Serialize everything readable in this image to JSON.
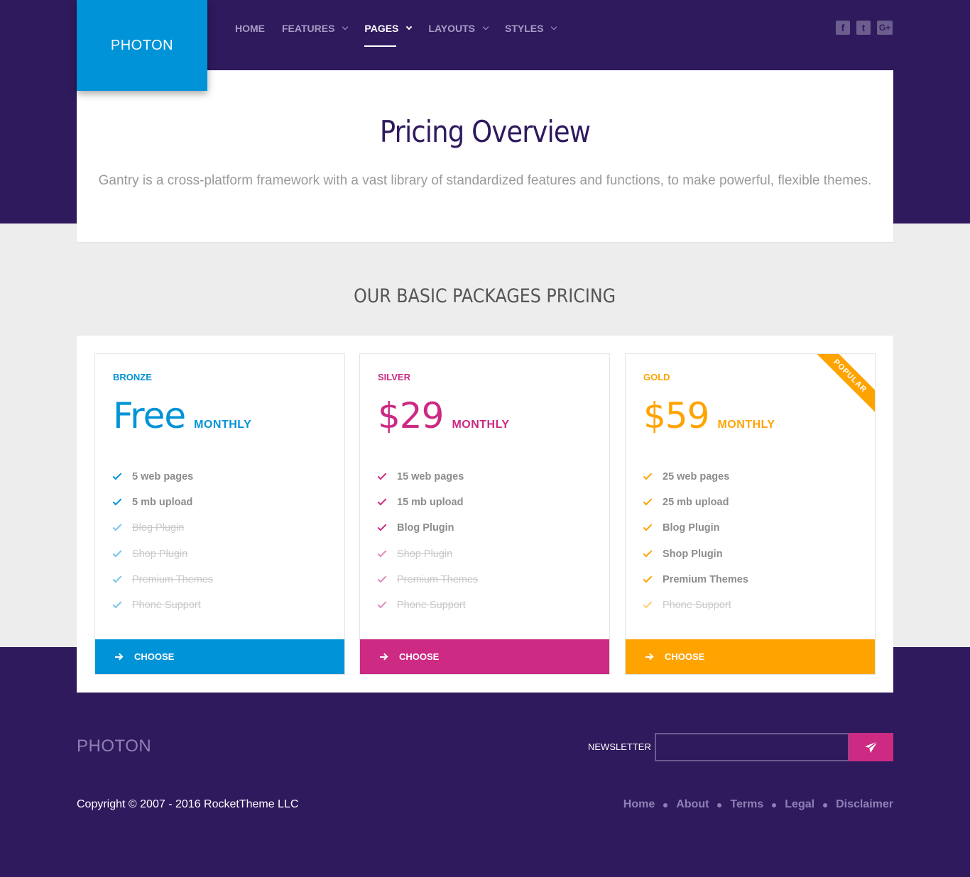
{
  "colors": {
    "brand_dark": "#2f1a5e",
    "bronze": "#0193d7",
    "silver": "#cc2a83",
    "gold": "#ffa300"
  },
  "header": {
    "logo": "PHOTON",
    "nav": [
      {
        "label": "HOME",
        "dropdown": false,
        "active": false
      },
      {
        "label": "FEATURES",
        "dropdown": true,
        "active": false
      },
      {
        "label": "PAGES",
        "dropdown": true,
        "active": true
      },
      {
        "label": "LAYOUTS",
        "dropdown": true,
        "active": false
      },
      {
        "label": "STYLES",
        "dropdown": true,
        "active": false
      }
    ],
    "social": [
      {
        "icon": "facebook-icon",
        "glyph": "f"
      },
      {
        "icon": "twitter-icon",
        "glyph": "t"
      },
      {
        "icon": "google-plus-icon",
        "glyph": "G+"
      }
    ]
  },
  "hero": {
    "title": "Pricing Overview",
    "subtitle": "Gantry is a cross-platform framework with a vast library of standardized features and functions, to make powerful, flexible themes."
  },
  "pricing": {
    "heading": "OUR BASIC PACKAGES PRICING",
    "plans": [
      {
        "tier": "BRONZE",
        "price": "Free",
        "period": "MONTHLY",
        "color": "#0193d7",
        "ribbon": "",
        "features": [
          {
            "label": "5 web pages",
            "included": true
          },
          {
            "label": "5 mb upload",
            "included": true
          },
          {
            "label": "Blog Plugin",
            "included": false
          },
          {
            "label": "Shop Plugin",
            "included": false
          },
          {
            "label": "Premium Themes",
            "included": false
          },
          {
            "label": "Phone Support",
            "included": false
          }
        ],
        "cta": "CHOOSE"
      },
      {
        "tier": "SILVER",
        "price": "$29",
        "period": "MONTHLY",
        "color": "#cc2a83",
        "ribbon": "",
        "features": [
          {
            "label": "15 web pages",
            "included": true
          },
          {
            "label": "15 mb upload",
            "included": true
          },
          {
            "label": "Blog Plugin",
            "included": true
          },
          {
            "label": "Shop Plugin",
            "included": false
          },
          {
            "label": "Premium Themes",
            "included": false
          },
          {
            "label": "Phone Support",
            "included": false
          }
        ],
        "cta": "CHOOSE"
      },
      {
        "tier": "GOLD",
        "price": "$59",
        "period": "MONTHLY",
        "color": "#ffa300",
        "ribbon": "POPULAR",
        "features": [
          {
            "label": "25 web pages",
            "included": true
          },
          {
            "label": "25 mb upload",
            "included": true
          },
          {
            "label": "Blog Plugin",
            "included": true
          },
          {
            "label": "Shop Plugin",
            "included": true
          },
          {
            "label": "Premium Themes",
            "included": true
          },
          {
            "label": "Phone Support",
            "included": false
          }
        ],
        "cta": "CHOOSE"
      }
    ]
  },
  "footer": {
    "logo": "PHOTON",
    "newsletter_label": "NEWSLETTER",
    "newsletter_placeholder": "",
    "copyright": "Copyright © 2007 - 2016 RocketTheme LLC",
    "links": [
      "Home",
      "About",
      "Terms",
      "Legal",
      "Disclaimer"
    ]
  }
}
